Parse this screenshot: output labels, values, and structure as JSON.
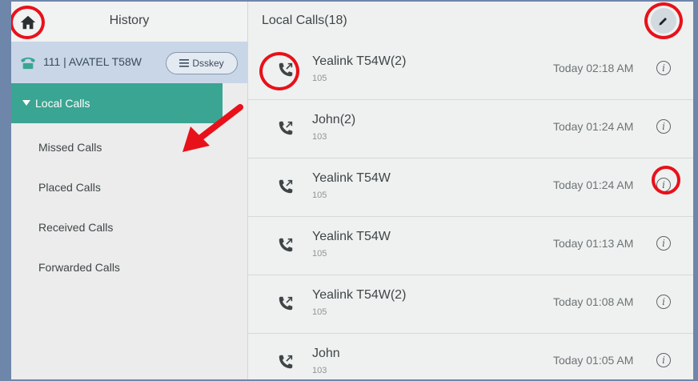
{
  "history_panel": {
    "title": "History",
    "account_label": "111 | AVATEL T58W",
    "dsskey_label": "Dsskey",
    "menu": {
      "local_calls": "Local Calls",
      "missed_calls": "Missed Calls",
      "placed_calls": "Placed Calls",
      "received_calls": "Received Calls",
      "forwarded_calls": "Forwarded Calls"
    }
  },
  "calls_panel": {
    "title": "Local Calls(18)",
    "calls": [
      {
        "name": "Yealink T54W(2)",
        "number": "105",
        "time": "Today 02:18 AM"
      },
      {
        "name": "John(2)",
        "number": "103",
        "time": "Today 01:24 AM"
      },
      {
        "name": "Yealink T54W",
        "number": "105",
        "time": "Today 01:24 AM"
      },
      {
        "name": "Yealink T54W",
        "number": "105",
        "time": "Today 01:13 AM"
      },
      {
        "name": "Yealink T54W(2)",
        "number": "105",
        "time": "Today 01:08 AM"
      },
      {
        "name": "John",
        "number": "103",
        "time": "Today 01:05 AM"
      }
    ]
  },
  "colors": {
    "accent": "#3aa592",
    "account_row": "#c9d6e8",
    "annotation": "#e8111a"
  },
  "icons": {
    "home": "home-icon",
    "edit": "pencil-icon",
    "dsskey": "list-icon",
    "call_type": "outgoing-call-icon",
    "info": "info-icon"
  }
}
